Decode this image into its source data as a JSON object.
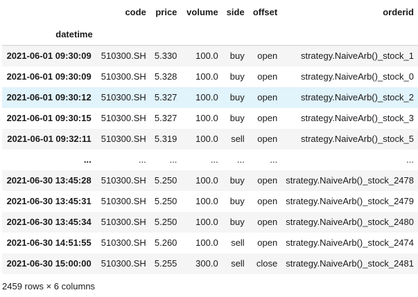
{
  "table": {
    "index_name": "datetime",
    "columns": [
      "code",
      "price",
      "volume",
      "side",
      "offset",
      "orderid"
    ],
    "rows": [
      {
        "index": "2021-06-01 09:30:09",
        "cells": [
          "510300.SH",
          "5.330",
          "100.0",
          "buy",
          "open",
          "strategy.NaiveArb()_stock_1"
        ]
      },
      {
        "index": "2021-06-01 09:30:09",
        "cells": [
          "510300.SH",
          "5.328",
          "100.0",
          "buy",
          "open",
          "strategy.NaiveArb()_stock_0"
        ]
      },
      {
        "index": "2021-06-01 09:30:12",
        "cells": [
          "510300.SH",
          "5.327",
          "100.0",
          "buy",
          "open",
          "strategy.NaiveArb()_stock_2"
        ]
      },
      {
        "index": "2021-06-01 09:30:15",
        "cells": [
          "510300.SH",
          "5.327",
          "100.0",
          "buy",
          "open",
          "strategy.NaiveArb()_stock_3"
        ]
      },
      {
        "index": "2021-06-01 09:32:11",
        "cells": [
          "510300.SH",
          "5.319",
          "100.0",
          "sell",
          "open",
          "strategy.NaiveArb()_stock_5"
        ]
      },
      {
        "index": "...",
        "cells": [
          "...",
          "...",
          "...",
          "...",
          "...",
          "..."
        ]
      },
      {
        "index": "2021-06-30 13:45:28",
        "cells": [
          "510300.SH",
          "5.250",
          "100.0",
          "buy",
          "open",
          "strategy.NaiveArb()_stock_2478"
        ]
      },
      {
        "index": "2021-06-30 13:45:31",
        "cells": [
          "510300.SH",
          "5.250",
          "100.0",
          "buy",
          "open",
          "strategy.NaiveArb()_stock_2479"
        ]
      },
      {
        "index": "2021-06-30 13:45:34",
        "cells": [
          "510300.SH",
          "5.250",
          "100.0",
          "buy",
          "open",
          "strategy.NaiveArb()_stock_2480"
        ]
      },
      {
        "index": "2021-06-30 14:51:55",
        "cells": [
          "510300.SH",
          "5.260",
          "100.0",
          "sell",
          "open",
          "strategy.NaiveArb()_stock_2474"
        ]
      },
      {
        "index": "2021-06-30 15:00:00",
        "cells": [
          "510300.SH",
          "5.255",
          "300.0",
          "sell",
          "close",
          "strategy.NaiveArb()_stock_2481"
        ]
      }
    ],
    "highlight_color": "#e1f3fb",
    "shape_text": "2459 rows × 6 columns"
  }
}
